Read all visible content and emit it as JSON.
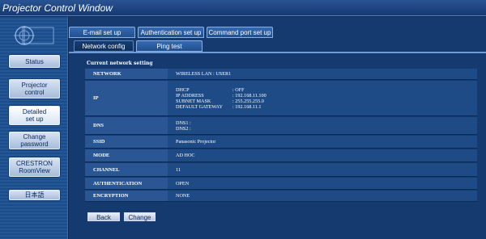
{
  "window": {
    "title": "Projector Control Window"
  },
  "sidebar": {
    "items": [
      {
        "lines": [
          "Status"
        ]
      },
      {
        "lines": [
          "Projector",
          "control"
        ]
      },
      {
        "lines": [
          "Detailed",
          "set up"
        ]
      },
      {
        "lines": [
          "Change",
          "password"
        ]
      },
      {
        "lines": [
          "CRESTRON",
          "RoomView"
        ]
      },
      {
        "lines": [
          "日本語"
        ]
      }
    ]
  },
  "tabs": {
    "row1": [
      "E-mail set up",
      "Authentication set up",
      "Command port set up"
    ],
    "row2": [
      "Network config",
      "Ping test"
    ]
  },
  "section_title": "Current network setting",
  "table": {
    "network": {
      "label": "NETWORK",
      "value": "WIRELESS LAN : USER1"
    },
    "ip": {
      "label": "IP",
      "dhcp": {
        "key": "DHCP",
        "value": ": OFF"
      },
      "ip_address": {
        "key": "IP ADDRESS",
        "value": ": 192.168.11.100"
      },
      "subnet": {
        "key": "SUBNET MASK",
        "value": ": 255.255.255.0"
      },
      "gateway": {
        "key": "DEFAULT GATEWAY",
        "value": ": 192.168.11.1"
      }
    },
    "dns": {
      "label": "DNS",
      "dns1": "DNS1 :",
      "dns2": "DNS2 :"
    },
    "ssid": {
      "label": "SSID",
      "value": "Panasonic Projector"
    },
    "mode": {
      "label": "MODE",
      "value": "AD HOC"
    },
    "channel": {
      "label": "CHANNEL",
      "value": "11"
    },
    "authentication": {
      "label": "AUTHENTICATION",
      "value": "OPEN"
    },
    "encryption": {
      "label": "ENCRYPTION",
      "value": "NONE"
    }
  },
  "buttons": {
    "back": "Back",
    "change": "Change"
  },
  "colors": {
    "background": "#0d2a55",
    "label_cell": "#2a5794",
    "value_cell": "#1e4a86"
  }
}
